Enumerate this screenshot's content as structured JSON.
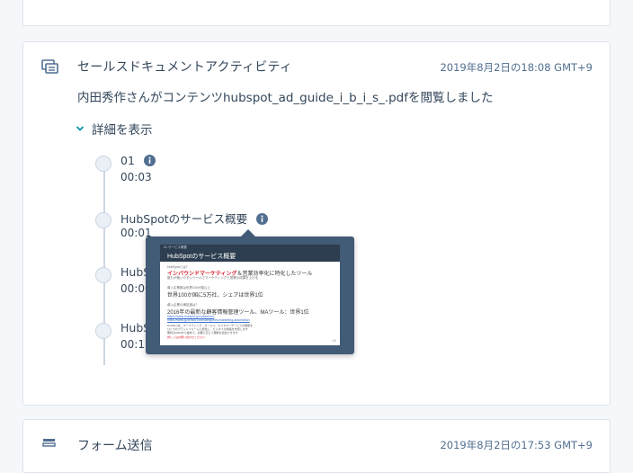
{
  "colors": {
    "accent": "#0091ae",
    "info": "#516f90",
    "text": "#33475b",
    "popover": "#425b76"
  },
  "activity": {
    "icon": "documents-icon",
    "title": "セールスドキュメントアクティビティ",
    "timestamp": "2019年8月2日の18:08 GMT+9",
    "description": "内田秀作さんがコンテンツhubspot_ad_guide_i_b_i_s_.pdfを閲覧しました",
    "details_toggle": "詳細を表示",
    "timeline": [
      {
        "title": "01",
        "time": "00:03"
      },
      {
        "title": "HubSpotのサービス概要",
        "time": "00:01"
      },
      {
        "title": "HubS",
        "time": "00:00"
      },
      {
        "title": "HubS",
        "time": "00:17"
      }
    ]
  },
  "preview": {
    "crumb": "01 サービス概要",
    "header": "HubSpotのサービス概要",
    "line1_small": "HubSpotとは？",
    "line2_red": "インバウンドマーケティング",
    "line2_rest": "＆営業効率化に特化したツール",
    "line3_small": "誰もが使いやすいツールでマーケティングと営業の成果を上げる",
    "line4_small": "導入企業数は世界100か国以上",
    "line5": "世界100か国に5万社、シェアは世界1位",
    "line6_small": "導入企業の満足度は？",
    "line7": "2016年の最新な顧客情報管理ツール、MAツール：世界1位",
    "link1": "https://www.hubspot.jp/customers",
    "link2": "https://www.g2crowd.com/categories/marketing-automation",
    "body1": "HubSpotは、マーケティング、セールス、カスタマーサービスの機能を",
    "body2": "ひとつのプラットフォームに統合し、ビジネスの成長を支援します",
    "body3": "無料のCRMから始めて、必要に応じて機能を追加できます",
    "redline": "詳しくはお問い合わせください",
    "page": "1/5"
  },
  "form_activity": {
    "icon": "form-icon",
    "title": "フォーム送信",
    "timestamp": "2019年8月2日の17:53 GMT+9"
  }
}
